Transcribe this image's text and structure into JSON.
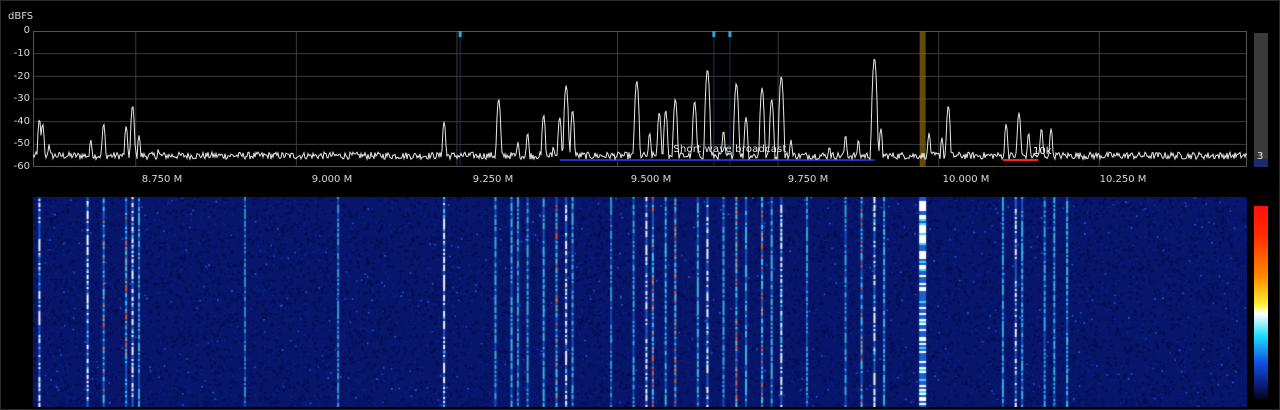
{
  "spectrum": {
    "unit_label": "dBFS",
    "y_ticks": [
      "0",
      "-10",
      "-20",
      "-30",
      "-40",
      "-50",
      "-60"
    ],
    "x_ticks": [
      "8.750 M",
      "9.000 M",
      "9.250 M",
      "9.500 M",
      "9.750 M",
      "10.000 M",
      "10.250 M"
    ],
    "band_label": "Short wave broadcast",
    "bandwidth_label": "10k",
    "range_value": "3"
  },
  "colors": {
    "trace": "#e8e8e8",
    "grid": "#3c3c3c",
    "band_marker": "#2030c8",
    "vfo_marker": "#ff2020",
    "bookmark": "#2fa8d8",
    "tuned_channel": "#8a6a10"
  },
  "chart_data": {
    "type": "line",
    "title": "",
    "xlabel": "",
    "ylabel": "dBFS",
    "xlim": [
      8.59,
      10.48
    ],
    "ylim": [
      -60,
      0
    ],
    "x_unit": "MHz",
    "noise_floor": -55,
    "peaks": [
      {
        "x": 8.6,
        "y": -39
      },
      {
        "x": 8.605,
        "y": -41
      },
      {
        "x": 8.615,
        "y": -50
      },
      {
        "x": 8.68,
        "y": -48
      },
      {
        "x": 8.7,
        "y": -41
      },
      {
        "x": 8.735,
        "y": -42
      },
      {
        "x": 8.745,
        "y": -33
      },
      {
        "x": 8.755,
        "y": -46
      },
      {
        "x": 8.785,
        "y": -52
      },
      {
        "x": 9.23,
        "y": -40
      },
      {
        "x": 9.315,
        "y": -30
      },
      {
        "x": 9.345,
        "y": -49
      },
      {
        "x": 9.36,
        "y": -45
      },
      {
        "x": 9.385,
        "y": -37
      },
      {
        "x": 9.4,
        "y": -51
      },
      {
        "x": 9.41,
        "y": -38
      },
      {
        "x": 9.42,
        "y": -24
      },
      {
        "x": 9.43,
        "y": -35
      },
      {
        "x": 9.53,
        "y": -22
      },
      {
        "x": 9.55,
        "y": -45
      },
      {
        "x": 9.565,
        "y": -36
      },
      {
        "x": 9.575,
        "y": -35
      },
      {
        "x": 9.59,
        "y": -30
      },
      {
        "x": 9.62,
        "y": -31
      },
      {
        "x": 9.64,
        "y": -17
      },
      {
        "x": 9.665,
        "y": -44
      },
      {
        "x": 9.685,
        "y": -23
      },
      {
        "x": 9.7,
        "y": -38
      },
      {
        "x": 9.725,
        "y": -25
      },
      {
        "x": 9.74,
        "y": -30
      },
      {
        "x": 9.755,
        "y": -20
      },
      {
        "x": 9.77,
        "y": -48
      },
      {
        "x": 9.83,
        "y": -51
      },
      {
        "x": 9.855,
        "y": -46
      },
      {
        "x": 9.875,
        "y": -48
      },
      {
        "x": 9.9,
        "y": -12
      },
      {
        "x": 9.91,
        "y": -43
      },
      {
        "x": 9.985,
        "y": -45
      },
      {
        "x": 10.005,
        "y": -47
      },
      {
        "x": 10.015,
        "y": -33
      },
      {
        "x": 10.105,
        "y": -41
      },
      {
        "x": 10.125,
        "y": -36
      },
      {
        "x": 10.14,
        "y": -45
      },
      {
        "x": 10.16,
        "y": -43
      },
      {
        "x": 10.175,
        "y": -43
      }
    ],
    "band": {
      "start": 9.41,
      "end": 9.9
    },
    "vfo": {
      "start": 10.1,
      "end": 10.155
    },
    "tuned_channel": 9.975,
    "bookmarks": [
      9.255,
      9.65,
      9.675
    ],
    "waterfall_lines": [
      {
        "x": 8.6,
        "i": 0.9
      },
      {
        "x": 8.675,
        "i": 1.0
      },
      {
        "x": 8.7,
        "i": 0.85
      },
      {
        "x": 8.735,
        "i": 0.8
      },
      {
        "x": 8.745,
        "i": 0.95
      },
      {
        "x": 8.755,
        "i": 0.6
      },
      {
        "x": 8.92,
        "i": 0.3
      },
      {
        "x": 9.065,
        "i": 0.45
      },
      {
        "x": 9.23,
        "i": 0.9
      },
      {
        "x": 9.31,
        "i": 0.6
      },
      {
        "x": 9.335,
        "i": 0.7
      },
      {
        "x": 9.345,
        "i": 0.55
      },
      {
        "x": 9.36,
        "i": 0.6
      },
      {
        "x": 9.385,
        "i": 0.7
      },
      {
        "x": 9.405,
        "i": 0.8
      },
      {
        "x": 9.42,
        "i": 0.9
      },
      {
        "x": 9.43,
        "i": 0.7
      },
      {
        "x": 9.49,
        "i": 0.4
      },
      {
        "x": 9.525,
        "i": 0.6
      },
      {
        "x": 9.545,
        "i": 0.9
      },
      {
        "x": 9.555,
        "i": 0.85
      },
      {
        "x": 9.575,
        "i": 0.7
      },
      {
        "x": 9.59,
        "i": 0.8
      },
      {
        "x": 9.625,
        "i": 0.7
      },
      {
        "x": 9.64,
        "i": 0.95
      },
      {
        "x": 9.665,
        "i": 0.6
      },
      {
        "x": 9.685,
        "i": 0.85
      },
      {
        "x": 9.7,
        "i": 0.7
      },
      {
        "x": 9.725,
        "i": 0.8
      },
      {
        "x": 9.74,
        "i": 0.7
      },
      {
        "x": 9.755,
        "i": 0.9
      },
      {
        "x": 9.795,
        "i": 0.5
      },
      {
        "x": 9.855,
        "i": 0.55
      },
      {
        "x": 9.88,
        "i": 0.8
      },
      {
        "x": 9.9,
        "i": 0.95
      },
      {
        "x": 9.915,
        "i": 0.7
      },
      {
        "x": 9.975,
        "i": 1.0
      },
      {
        "x": 10.1,
        "i": 0.6
      },
      {
        "x": 10.12,
        "i": 0.9
      },
      {
        "x": 10.13,
        "i": 0.7
      },
      {
        "x": 10.165,
        "i": 0.6
      },
      {
        "x": 10.18,
        "i": 0.65
      },
      {
        "x": 10.2,
        "i": 0.7
      }
    ]
  }
}
